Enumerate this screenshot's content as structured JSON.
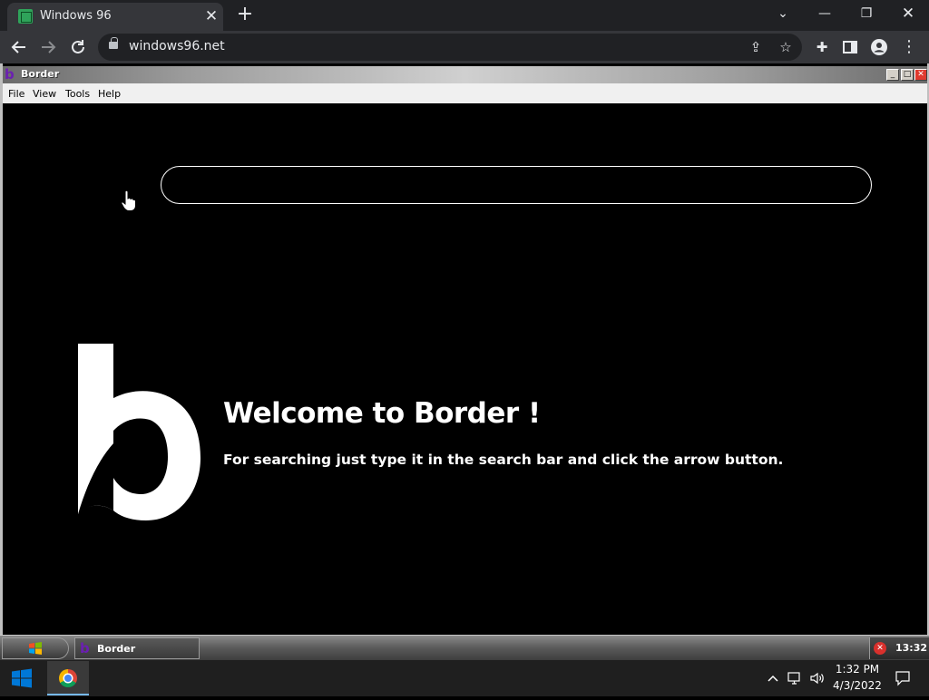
{
  "browser": {
    "tab_title": "Windows 96",
    "url": "windows96.net",
    "icons": {
      "new_tab": "plus-icon",
      "back": "arrow-left-icon",
      "forward": "arrow-right-icon",
      "reload": "reload-icon",
      "share": "share-icon",
      "bookmark": "star-icon",
      "extensions": "puzzle-icon",
      "side_panel": "side-panel-icon",
      "profile": "profile-icon",
      "menu": "kebab-menu-icon"
    }
  },
  "w96_window": {
    "title": "Border",
    "menu": [
      "File",
      "View",
      "Tools",
      "Help"
    ]
  },
  "border_app": {
    "search_placeholder": "",
    "heading": "Welcome to Border !",
    "instructions": "For searching just type it in the search bar and click the arrow button.",
    "brand_color": "#6b1fb1"
  },
  "w96_taskbar": {
    "task_label": "Border",
    "clock": "13:32"
  },
  "win_taskbar": {
    "time": "1:32 PM",
    "date": "4/3/2022",
    "accent": "#76b9ed"
  }
}
